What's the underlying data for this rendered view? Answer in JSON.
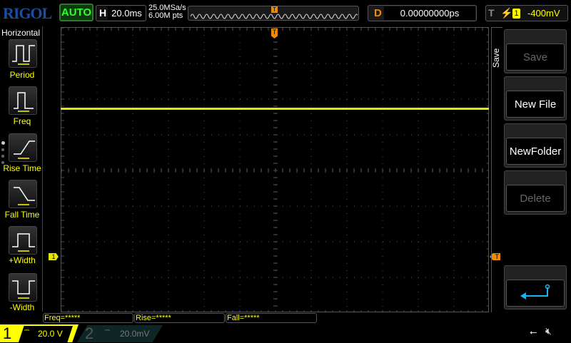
{
  "header": {
    "logo": "RIGOL",
    "mode": "AUTO",
    "h_label": "H",
    "timebase": "20.0ms",
    "sample_rate": "25.0MSa/s",
    "memory_depth": "6.00M pts",
    "d_label": "D",
    "delay": "0.00000000ps",
    "t_label": "T",
    "trigger_source": "1",
    "trigger_level": "-400mV",
    "trigger_slope_icon": "rising-edge-icon"
  },
  "sidebar": {
    "title": "Horizontal",
    "items": [
      {
        "label": "Period"
      },
      {
        "label": "Freq"
      },
      {
        "label": "Rise Time"
      },
      {
        "label": "Fall Time"
      },
      {
        "label": "+Width"
      },
      {
        "label": "-Width"
      }
    ]
  },
  "menu": {
    "title": "Save",
    "buttons": [
      {
        "label": "Save",
        "enabled": false
      },
      {
        "label": "New File",
        "enabled": true
      },
      {
        "label": "NewFolder",
        "enabled": true
      },
      {
        "label": "Delete",
        "enabled": false
      }
    ],
    "back_icon": "return-arrow-icon"
  },
  "measurements": [
    "Freq=*****",
    "Rise=*****",
    "Fall=*****"
  ],
  "channels": [
    {
      "num": "1",
      "scale": "20.0 V",
      "color": "#ffff00",
      "active": true
    },
    {
      "num": "2",
      "scale": "20.0mV",
      "color": "#00c0c0",
      "active": false
    }
  ],
  "markers": {
    "trigger": "T",
    "ch1": "1"
  },
  "colors": {
    "ch1": "#e6e600",
    "trigger": "#f08a00",
    "grid": "#555555"
  }
}
